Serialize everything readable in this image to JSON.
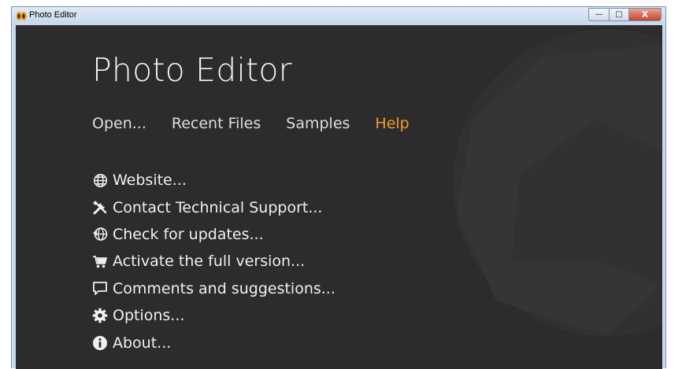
{
  "window": {
    "title": "Photo Editor",
    "controls": {
      "minimize": "—",
      "maximize": "□",
      "close": "X"
    }
  },
  "app": {
    "title": "Photo Editor"
  },
  "tabs": [
    {
      "label": "Open..."
    },
    {
      "label": "Recent Files"
    },
    {
      "label": "Samples"
    },
    {
      "label": "Help"
    }
  ],
  "active_tab": "Help",
  "menu": [
    {
      "label": "Website...",
      "icon": "globe-icon"
    },
    {
      "label": "Contact Technical Support...",
      "icon": "tools-icon"
    },
    {
      "label": "Check for updates...",
      "icon": "update-globe-icon"
    },
    {
      "label": "Activate the full version...",
      "icon": "cart-icon"
    },
    {
      "label": "Comments and suggestions...",
      "icon": "comment-icon"
    },
    {
      "label": "Options...",
      "icon": "gear-icon"
    },
    {
      "label": "About...",
      "icon": "info-icon"
    }
  ],
  "colors": {
    "background": "#2c2b2d",
    "accent": "#f39c2b",
    "text": "#f0f0f0"
  }
}
